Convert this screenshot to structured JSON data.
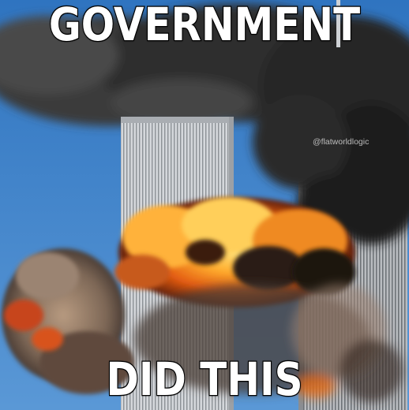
{
  "meme": {
    "top_text": "GOVERNMENT",
    "bottom_text": "DID THIS",
    "watermark": "@flatworldlogic"
  },
  "colors": {
    "sky": "#3f7fc4",
    "smoke": "#2b2b2b",
    "tower": "#c9ccd0",
    "fire": "#f08a1c",
    "caption_fill": "#ffffff",
    "caption_stroke": "#000000"
  }
}
